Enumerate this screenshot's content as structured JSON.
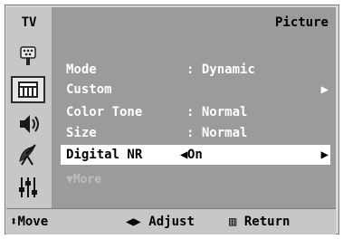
{
  "header": {
    "source_label": "TV",
    "menu_title": "Picture"
  },
  "sidebar": {
    "items": [
      {
        "icon": "input-icon",
        "active": false
      },
      {
        "icon": "picture-icon",
        "active": true
      },
      {
        "icon": "sound-icon",
        "active": false
      },
      {
        "icon": "channel-antenna-icon",
        "active": false
      },
      {
        "icon": "setup-sliders-icon",
        "active": false
      }
    ]
  },
  "menu": {
    "rows": [
      {
        "label": "Mode",
        "separator": ":",
        "value": "Dynamic"
      },
      {
        "label": "Custom",
        "arrow": "▶"
      },
      {
        "label": "Color Tone",
        "separator": ":",
        "value": "Normal"
      },
      {
        "label": "Size",
        "separator": ":",
        "value": "Normal"
      },
      {
        "label": "Digital NR",
        "value": "On",
        "arrow_left": "◀",
        "arrow_right": "▶",
        "selected": true
      }
    ],
    "more_label": "▼More"
  },
  "footer": {
    "move_label": "Move",
    "adjust_label": "Adjust",
    "return_label": "Return"
  },
  "colors": {
    "background": "#d9d9d9",
    "bar": "#9b9b9b",
    "highlight": "#ffffff",
    "text": "#ffffff"
  }
}
